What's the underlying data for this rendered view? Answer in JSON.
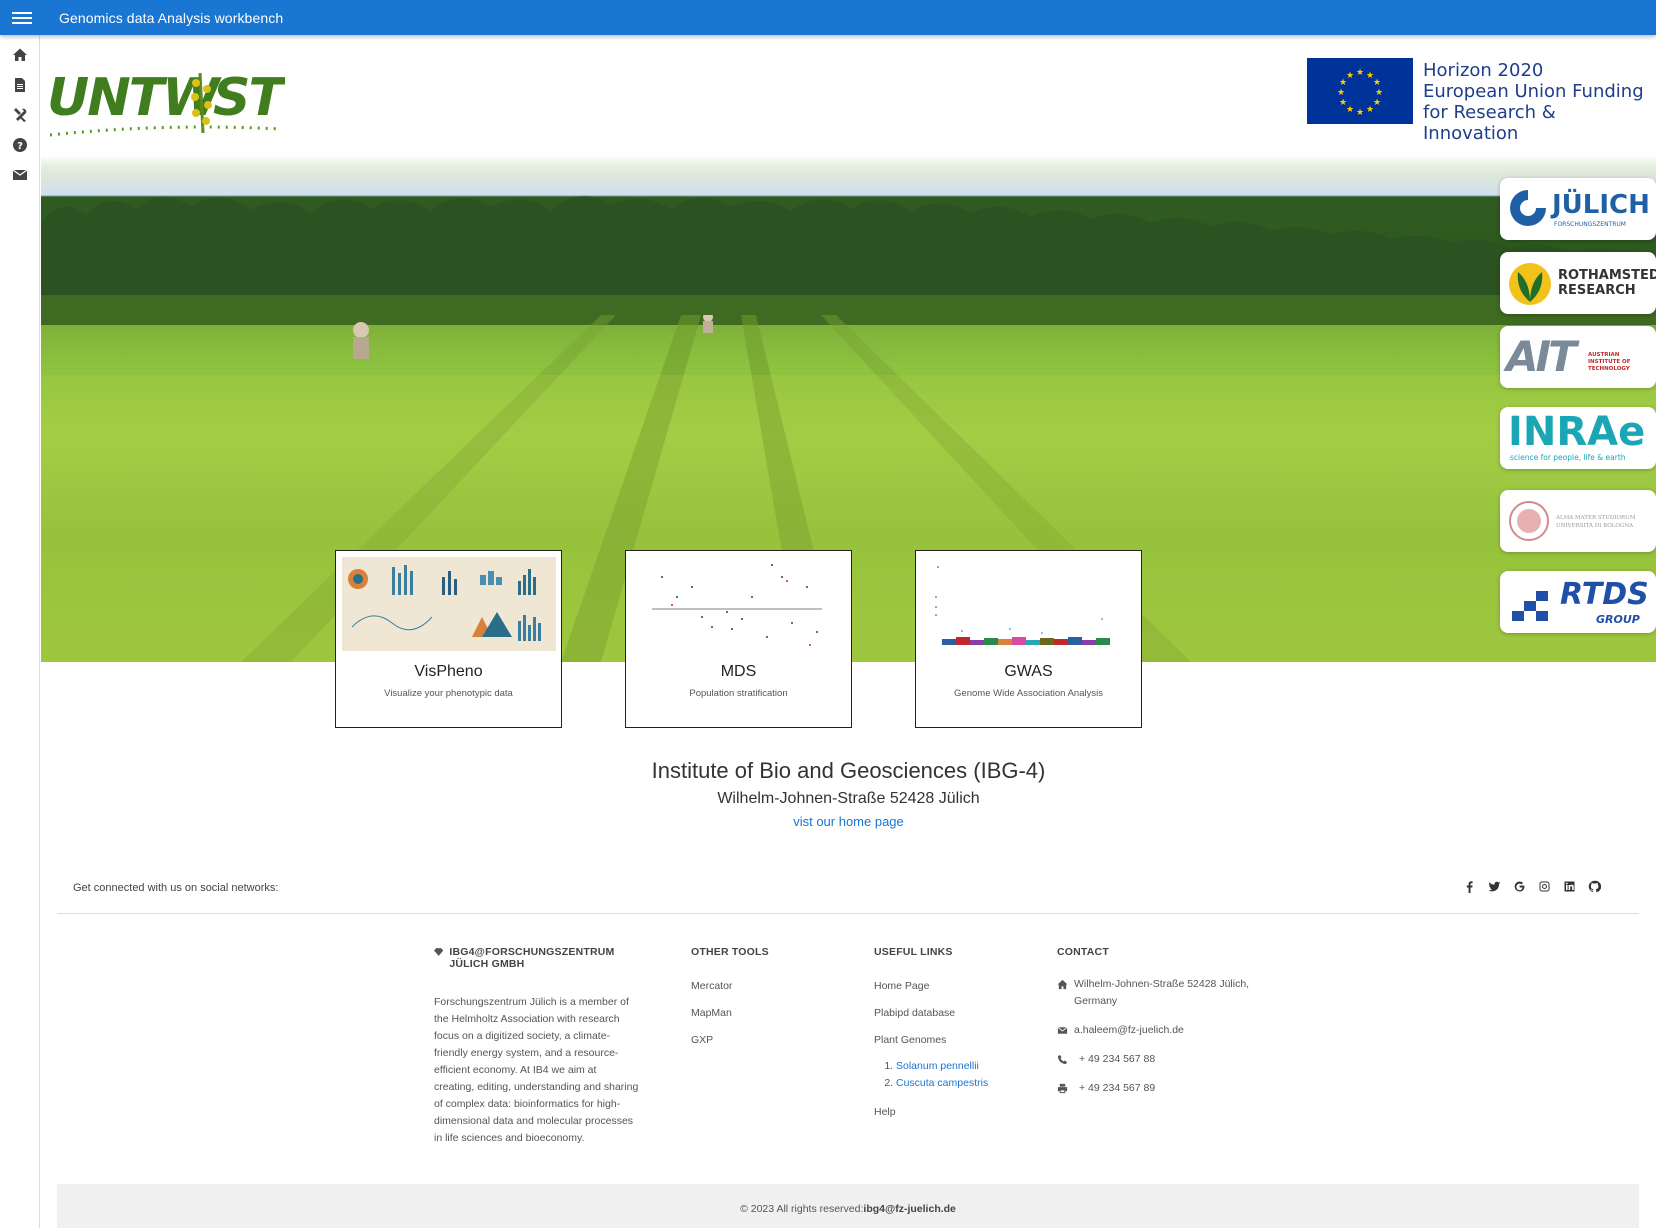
{
  "header": {
    "title": "Genomics data Analysis workbench"
  },
  "sidebar": {
    "items": [
      "home-icon",
      "document-icon",
      "tools-icon",
      "help-icon",
      "mail-icon"
    ]
  },
  "hero": {
    "horizon": {
      "line1": "Horizon 2020",
      "line2": "European Union Funding",
      "line3": "for Research & Innovation"
    },
    "partners": {
      "julich": {
        "name": "JÜLICH",
        "sub": "FORSCHUNGSZENTRUM"
      },
      "rothamsted": {
        "line1": "ROTHAMSTED",
        "line2": "RESEARCH"
      },
      "ait": {
        "name": "AIT",
        "sub": "AUSTRIAN INSTITUTE OF TECHNOLOGY"
      },
      "inrae": {
        "name": "INRAe",
        "sub": "science for people, life & earth"
      },
      "bologna": {
        "line1": "ALMA MATER STUDIORUM",
        "line2": "UNIVERSITÀ DI BOLOGNA"
      },
      "rtds": {
        "name": "RTDS",
        "sub": "GROUP"
      }
    }
  },
  "cards": [
    {
      "title": "VisPheno",
      "subtitle": "Visualize your phenotypic data"
    },
    {
      "title": "MDS",
      "subtitle": "Population stratification"
    },
    {
      "title": "GWAS",
      "subtitle": "Genome Wide Association Analysis"
    }
  ],
  "institute": {
    "name": "Institute of Bio and Geosciences (IBG-4)",
    "address": "Wilhelm-Johnen-Straße 52428 Jülich",
    "link": "vist our home page"
  },
  "social": {
    "text": "Get connected with us on social networks:",
    "icons": [
      "facebook-icon",
      "twitter-icon",
      "google-icon",
      "instagram-icon",
      "linkedin-icon",
      "github-icon"
    ]
  },
  "footer": {
    "about": {
      "heading": "IBG4@FORSCHUNGSZENTRUM JÜLICH GMBH",
      "text": "Forschungszentrum Jülich is a member of the Helmholtz Association with research focus on a digitized society, a climate-friendly energy system, and a resource-efficient economy. At IB4 we aim at creating, editing, understanding and sharing of complex data: bioinformatics for high-dimensional data and molecular processes in life sciences and bioeconomy."
    },
    "tools": {
      "heading": "OTHER TOOLS",
      "items": [
        "Mercator",
        "MapMan",
        "GXP"
      ]
    },
    "links": {
      "heading": "USEFUL LINKS",
      "items": [
        "Home Page",
        "Plabipd database",
        "Plant Genomes"
      ],
      "genomes": [
        "Solanum pennellii",
        "Cuscuta campestris"
      ],
      "help": "Help"
    },
    "contact": {
      "heading": "CONTACT",
      "address": "Wilhelm-Johnen-Straße 52428 Jülich, Germany",
      "email": "a.haleem@fz-juelich.de",
      "phone": "+ 49 234 567 88",
      "fax": "+ 49 234 567 89"
    },
    "copyright_prefix": "© 2023 All rights reserved:",
    "copyright_email": "ibg4@fz-juelich.de"
  }
}
